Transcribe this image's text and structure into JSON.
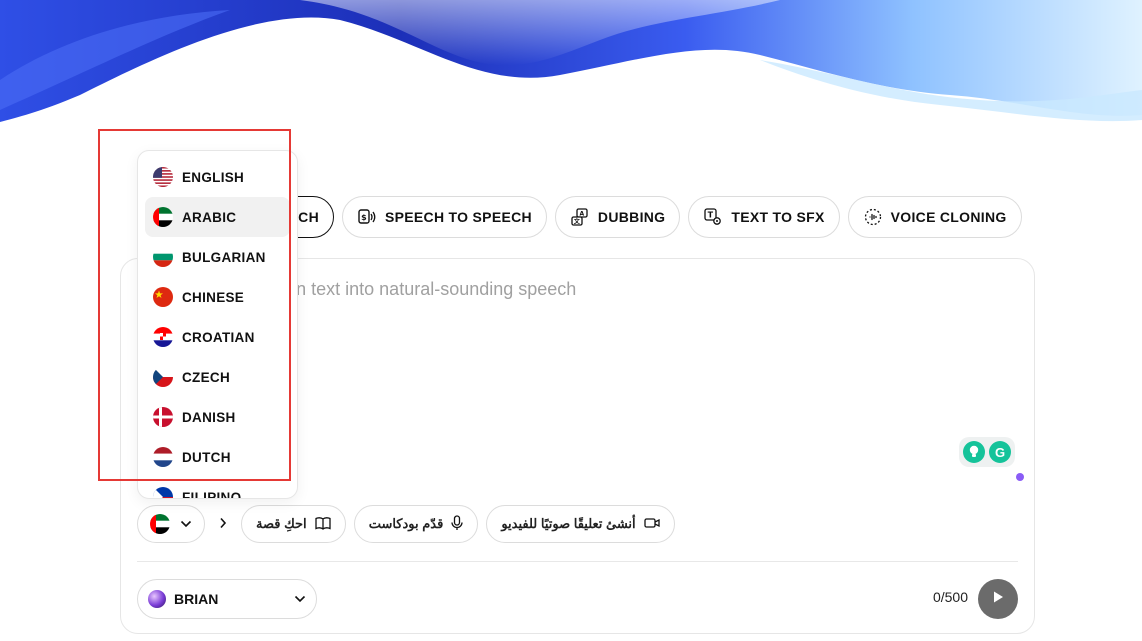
{
  "tabs": [
    {
      "label": "ECH",
      "icon": "text-to-speech-icon",
      "active": true
    },
    {
      "label": "SPEECH TO SPEECH",
      "icon": "speech-to-speech-icon"
    },
    {
      "label": "DUBBING",
      "icon": "dubbing-icon"
    },
    {
      "label": "TEXT TO SFX",
      "icon": "text-to-sfx-icon"
    },
    {
      "label": "VOICE CLONING",
      "icon": "voice-cloning-icon"
    }
  ],
  "editor": {
    "placeholder": "ny language and turn text into natural-sounding speech"
  },
  "grammarly": {
    "icon": "grammarly-icon",
    "assist_icon": "bulb-icon",
    "letter": "G"
  },
  "language_menu": {
    "items": [
      {
        "label": "ENGLISH",
        "flag": "us-flag-icon"
      },
      {
        "label": "ARABIC",
        "flag": "uae-flag-icon",
        "hover": true
      },
      {
        "label": "BULGARIAN",
        "flag": "bulgaria-flag-icon"
      },
      {
        "label": "CHINESE",
        "flag": "china-flag-icon"
      },
      {
        "label": "CROATIAN",
        "flag": "croatia-flag-icon"
      },
      {
        "label": "CZECH",
        "flag": "czech-flag-icon"
      },
      {
        "label": "DANISH",
        "flag": "denmark-flag-icon"
      },
      {
        "label": "DUTCH",
        "flag": "netherlands-flag-icon"
      },
      {
        "label": "FILIPINO",
        "flag": "philippines-flag-icon"
      }
    ]
  },
  "suggestions": [
    {
      "label": "احكِ قصة",
      "icon": "book-icon"
    },
    {
      "label": "قدّم بودكاست",
      "icon": "microphone-icon"
    },
    {
      "label": "أنشئ تعليقًا صوتيًا للفيديو",
      "icon": "video-camera-icon"
    }
  ],
  "voice": {
    "name": "BRIAN"
  },
  "counter": "0/500",
  "colors": {
    "accent_highlight": "#e53935",
    "play_button": "#6b6b6b",
    "grammarly_green": "#15c39a"
  }
}
